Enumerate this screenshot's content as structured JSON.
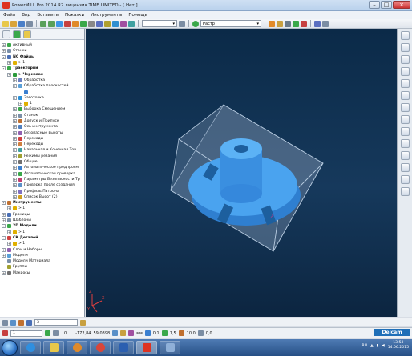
{
  "window": {
    "title": "PowerMILL Pro 2014 R2 лицензия TIME LIMITED - [ Нет ]"
  },
  "menu": [
    "Файл",
    "Вид",
    "Вставить",
    "Показки",
    "Инструменты",
    "Помощь"
  ],
  "toolbar": {
    "combo1_value": "",
    "combo2_value": "Растр"
  },
  "tree": [
    {
      "label": "Активный",
      "level": 0,
      "toggle": "+",
      "icon_color": "#3aa84a",
      "bold": false
    },
    {
      "label": "Станки",
      "level": 0,
      "toggle": "+",
      "icon_color": "#7a8fa8",
      "bold": false
    },
    {
      "label": "NC Файлы",
      "level": 0,
      "toggle": "-",
      "icon_color": "#4a6fb5",
      "bold": true
    },
    {
      "label": "> 1",
      "level": 1,
      "toggle": "+",
      "icon_color": "#e0b000",
      "bold": false
    },
    {
      "label": "Траектории",
      "level": 0,
      "toggle": "-",
      "icon_color": "#3aa84a",
      "bold": true
    },
    {
      "label": "> Черновая",
      "level": 1,
      "toggle": "-",
      "icon_color": "#2a9a3a",
      "bold": true
    },
    {
      "label": "Обработка",
      "level": 2,
      "toggle": "+",
      "icon_color": "#6a7fc0",
      "bold": false
    },
    {
      "label": "Обработка плоскостей",
      "level": 2,
      "toggle": "+",
      "icon_color": "#5aa0d8",
      "bold": false
    },
    {
      "label": "",
      "level": 3,
      "toggle": "",
      "icon_color": "#3a7fd0",
      "bold": false
    },
    {
      "label": "Заготовка",
      "level": 2,
      "toggle": "+",
      "icon_color": "#2a8fd8",
      "bold": false
    },
    {
      "label": "1",
      "level": 3,
      "toggle": "+",
      "icon_color": "#e0b000",
      "bold": false
    },
    {
      "label": "Выборка Смещением",
      "level": 2,
      "toggle": "+",
      "icon_color": "#3aa84a",
      "bold": false
    },
    {
      "label": "Станок",
      "level": 2,
      "toggle": "+",
      "icon_color": "#7a8fa8",
      "bold": false
    },
    {
      "label": "Допуск и Припуск",
      "level": 2,
      "toggle": "+",
      "icon_color": "#c07030",
      "bold": false
    },
    {
      "label": "Ось инструмента",
      "level": 2,
      "toggle": "+",
      "icon_color": "#5080c0",
      "bold": false
    },
    {
      "label": "Безопасные высоты",
      "level": 2,
      "toggle": "+",
      "icon_color": "#9060b0",
      "bold": false
    },
    {
      "label": "Переходы",
      "level": 2,
      "toggle": "+",
      "icon_color": "#d04040",
      "bold": false
    },
    {
      "label": "Переходы",
      "level": 2,
      "toggle": "+",
      "icon_color": "#d08040",
      "bold": false
    },
    {
      "label": "Начальная и Конечная Точ",
      "level": 2,
      "toggle": "+",
      "icon_color": "#40a0a0",
      "bold": false
    },
    {
      "label": "Режимы резания",
      "level": 2,
      "toggle": "+",
      "icon_color": "#a0a030",
      "bold": false
    },
    {
      "label": "Общие",
      "level": 2,
      "toggle": "+",
      "icon_color": "#707070",
      "bold": false
    },
    {
      "label": "Автоматическое предпросм",
      "level": 2,
      "toggle": "+",
      "icon_color": "#3a7fd0",
      "bold": false
    },
    {
      "label": "Автоматическая проверка",
      "level": 2,
      "toggle": "+",
      "icon_color": "#3aa84a",
      "bold": false
    },
    {
      "label": "Параметры Безопасности Тр",
      "level": 2,
      "toggle": "+",
      "icon_color": "#c04070",
      "bold": false
    },
    {
      "label": "Проверка после создания",
      "level": 2,
      "toggle": "+",
      "icon_color": "#5a90c8",
      "bold": false
    },
    {
      "label": "Профиль Патрона",
      "level": 2,
      "toggle": "+",
      "icon_color": "#8070c0",
      "bold": false
    },
    {
      "label": "Список Высот (2)",
      "level": 2,
      "toggle": "+",
      "icon_color": "#d0a020",
      "bold": false
    },
    {
      "label": "Инструменты",
      "level": 0,
      "toggle": "-",
      "icon_color": "#c07030",
      "bold": true
    },
    {
      "label": "> 1",
      "level": 1,
      "toggle": "+",
      "icon_color": "#e0b000",
      "bold": false
    },
    {
      "label": "Границы",
      "level": 0,
      "toggle": "+",
      "icon_color": "#4a6fb5",
      "bold": false
    },
    {
      "label": "Шаблоны",
      "level": 0,
      "toggle": "+",
      "icon_color": "#7a8fa8",
      "bold": false
    },
    {
      "label": "2D Модели",
      "level": 0,
      "toggle": "-",
      "icon_color": "#3aa84a",
      "bold": true
    },
    {
      "label": "> 1",
      "level": 1,
      "toggle": "+",
      "icon_color": "#e0b000",
      "bold": false
    },
    {
      "label": "СК Деталей",
      "level": 0,
      "toggle": "-",
      "icon_color": "#d04040",
      "bold": true
    },
    {
      "label": "> 1",
      "level": 1,
      "toggle": "+",
      "icon_color": "#e0b000",
      "bold": false
    },
    {
      "label": "Слои и Наборы",
      "level": 0,
      "toggle": "+",
      "icon_color": "#9060b0",
      "bold": false
    },
    {
      "label": "Модели",
      "level": 0,
      "toggle": "+",
      "icon_color": "#5aa0d8",
      "bold": false
    },
    {
      "label": "Модели Материала",
      "level": 0,
      "toggle": "",
      "icon_color": "#7a8fa8",
      "bold": false
    },
    {
      "label": "Группы",
      "level": 0,
      "toggle": "",
      "icon_color": "#a0a030",
      "bold": false
    },
    {
      "label": "Макросы",
      "level": 0,
      "toggle": "+",
      "icon_color": "#707070",
      "bold": false
    }
  ],
  "viewport": {
    "background_top": "#0b2a48",
    "part_color": "#3d95e8",
    "box_color": "#9fb8d3"
  },
  "bottom_toolbar_1": {
    "combo_value": "3"
  },
  "bottom_toolbar_2": {
    "combo_value": "1",
    "field_1": "0",
    "coord_x": "-172,84",
    "coord_y": "59,0398",
    "unit": "мм",
    "tol": "0,1",
    "step": "1,5",
    "angle": "10,0",
    "value2": "0,0",
    "brand": "Delcam"
  },
  "taskbar": {
    "lang": "RU",
    "time": "13:53",
    "date": "14.06.2015"
  }
}
